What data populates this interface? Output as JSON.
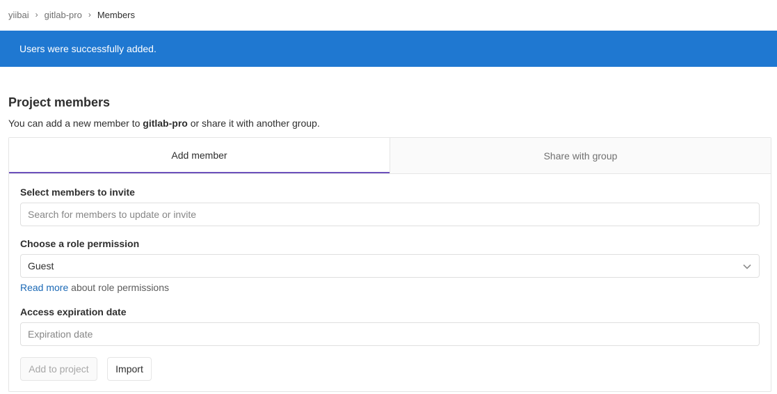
{
  "breadcrumb": {
    "items": [
      "yiibai",
      "gitlab-pro",
      "Members"
    ],
    "separator": "›"
  },
  "flash": {
    "message": "Users were successfully added.",
    "color": "#1f78d1"
  },
  "page": {
    "title": "Project members",
    "desc_prefix": "You can add a new member to ",
    "project_name": "gitlab-pro",
    "desc_suffix": " or share it with another group."
  },
  "tabs": [
    {
      "label": "Add member",
      "active": true
    },
    {
      "label": "Share with group",
      "active": false
    }
  ],
  "form": {
    "members_label": "Select members to invite",
    "members_placeholder": "Search for members to update or invite",
    "role_label": "Choose a role permission",
    "role_value": "Guest",
    "help_link": "Read more",
    "help_suffix": " about role permissions",
    "expiration_label": "Access expiration date",
    "expiration_placeholder": "Expiration date",
    "add_button": "Add to project",
    "import_button": "Import"
  },
  "icons": {
    "role_dropdown": "chevron-down-icon"
  },
  "colors": {
    "active_tab_underline": "#6b4fbb",
    "link": "#1b69b6"
  }
}
